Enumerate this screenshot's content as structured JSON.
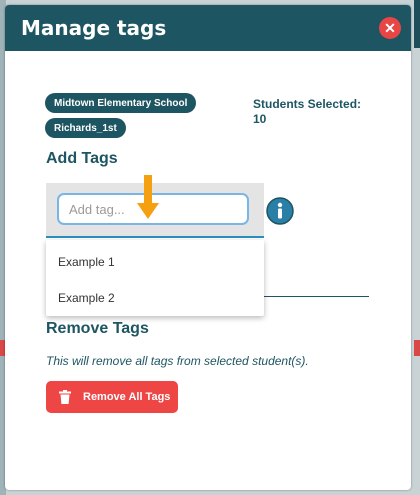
{
  "modal": {
    "title": "Manage tags",
    "close_label": "✕"
  },
  "context": {
    "school_tag": "Midtown Elementary School",
    "class_tag": "Richards_1st",
    "students_selected_label": "Students Selected:",
    "students_selected_count": "10"
  },
  "add_tags": {
    "title": "Add Tags",
    "input_placeholder": "Add tag...",
    "input_value": "",
    "options": [
      "Example 1",
      "Example 2"
    ],
    "info_icon": "info-icon"
  },
  "remove_tags": {
    "title": "Remove Tags",
    "description": "This will remove all tags from selected student(s).",
    "button_label": "Remove All Tags",
    "button_icon": "trash-icon"
  },
  "colors": {
    "primary": "#1e5562",
    "danger": "#ee4545",
    "accent_arrow": "#f5a011",
    "info": "#2a7fa6"
  }
}
